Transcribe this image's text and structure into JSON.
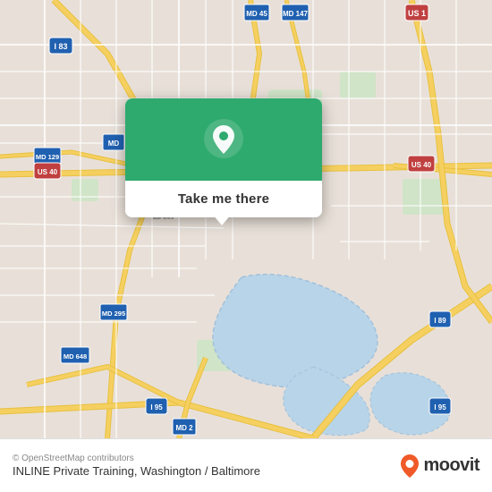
{
  "map": {
    "background_color": "#e8e0d8",
    "water_color": "#b8d4e8",
    "road_color": "#f5d060",
    "road_stroke": "#e8c040",
    "road_minor_color": "#ffffff",
    "green_area_color": "#c8dcc8"
  },
  "popup": {
    "button_label": "Take me there",
    "bg_color": "#2eaa6e",
    "pin_icon": "map-pin"
  },
  "footer": {
    "copyright": "© OpenStreetMap contributors",
    "title": "INLINE Private Training, Washington / Baltimore",
    "moovit_label": "moovit"
  }
}
